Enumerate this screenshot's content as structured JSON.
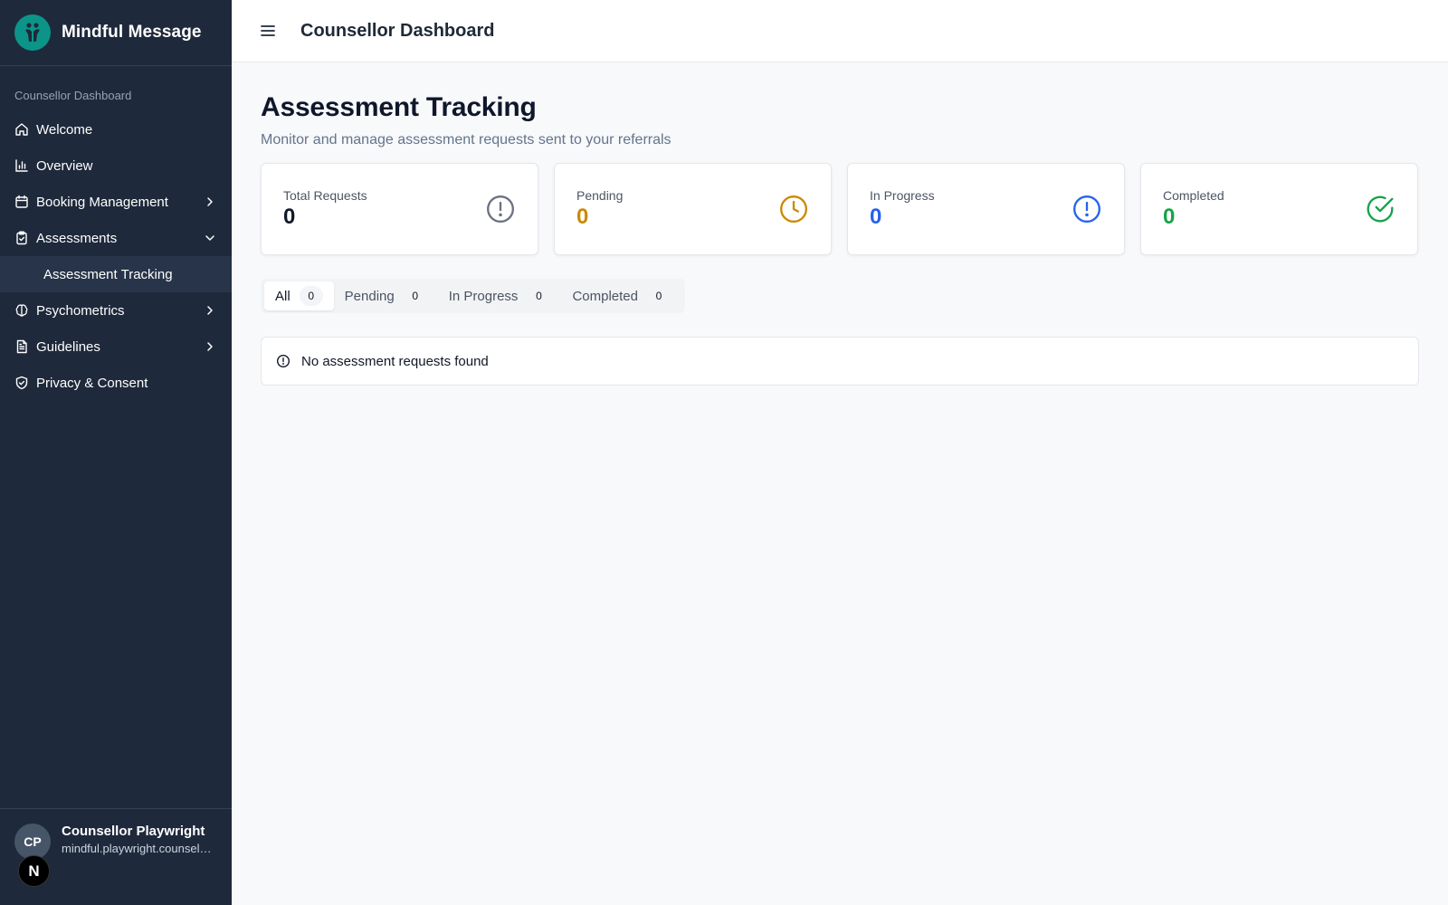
{
  "sidebar": {
    "brand": "Mindful Message",
    "section_label": "Counsellor Dashboard",
    "items": [
      {
        "label": "Welcome"
      },
      {
        "label": "Overview"
      },
      {
        "label": "Booking Management"
      },
      {
        "label": "Assessments"
      },
      {
        "label": "Assessment Tracking"
      },
      {
        "label": "Psychometrics"
      },
      {
        "label": "Guidelines"
      },
      {
        "label": "Privacy & Consent"
      }
    ],
    "user": {
      "initials": "CP",
      "name": "Counsellor Playwright",
      "email": "mindful.playwright.counsellor@example.com"
    },
    "badge": "N"
  },
  "header": {
    "title": "Counsellor Dashboard"
  },
  "main": {
    "title": "Assessment Tracking",
    "subtitle": "Monitor and manage assessment requests sent to your referrals",
    "cards": [
      {
        "label": "Total Requests",
        "value": "0",
        "color": "#111827",
        "icon": "alert-circle-icon"
      },
      {
        "label": "Pending",
        "value": "0",
        "color": "#ca8a04",
        "icon": "clock-icon"
      },
      {
        "label": "In Progress",
        "value": "0",
        "color": "#2563eb",
        "icon": "alert-circle-icon"
      },
      {
        "label": "Completed",
        "value": "0",
        "color": "#16a34a",
        "icon": "check-circle-icon"
      }
    ],
    "tabs": [
      {
        "label": "All",
        "count": "0"
      },
      {
        "label": "Pending",
        "count": "0"
      },
      {
        "label": "In Progress",
        "count": "0"
      },
      {
        "label": "Completed",
        "count": "0"
      }
    ],
    "empty_message": "No assessment requests found"
  }
}
